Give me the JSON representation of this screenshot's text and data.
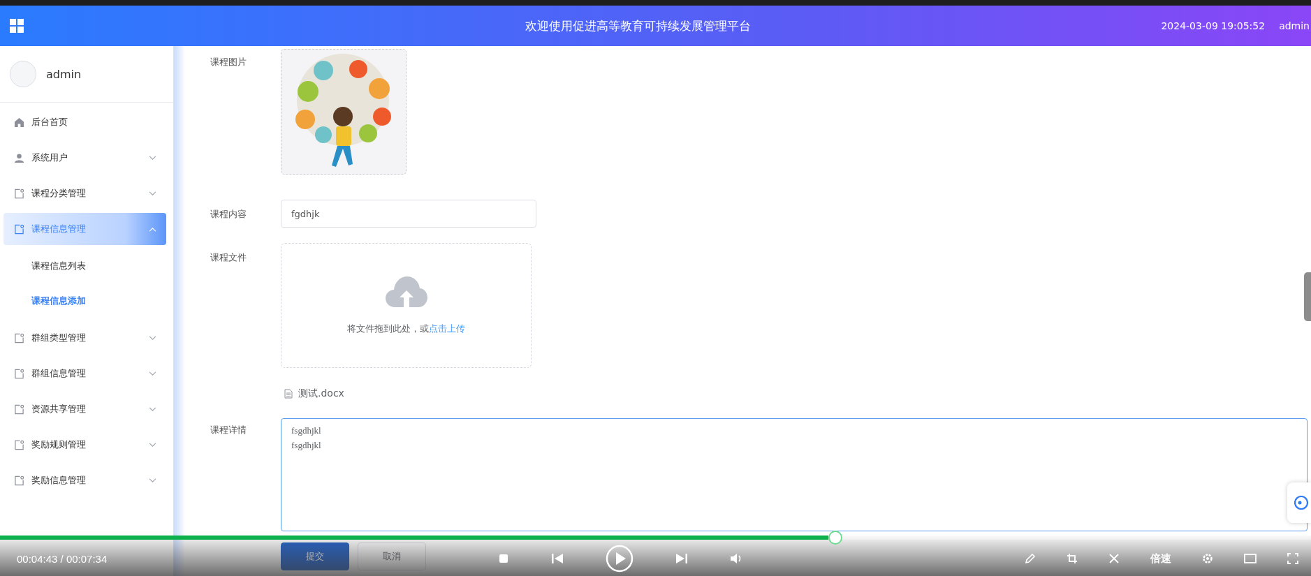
{
  "header": {
    "title": "欢迎使用促进高等教育可持续发展管理平台",
    "datetime": "2024-03-09 19:05:52",
    "user": "admin"
  },
  "sidebar": {
    "user": "admin",
    "items": [
      {
        "label": "后台首页",
        "selected": false
      },
      {
        "label": "系统用户",
        "selected": false,
        "expanded": false
      },
      {
        "label": "课程分类管理",
        "selected": false,
        "expanded": false
      },
      {
        "label": "课程信息管理",
        "selected": true,
        "expanded": true,
        "children": [
          {
            "label": "课程信息列表",
            "selected": false
          },
          {
            "label": "课程信息添加",
            "selected": true
          }
        ]
      },
      {
        "label": "群组类型管理",
        "selected": false,
        "expanded": false
      },
      {
        "label": "群组信息管理",
        "selected": false,
        "expanded": false
      },
      {
        "label": "资源共享管理",
        "selected": false,
        "expanded": false
      },
      {
        "label": "奖励规则管理",
        "selected": false,
        "expanded": false
      },
      {
        "label": "奖励信息管理",
        "selected": false,
        "expanded": false
      }
    ]
  },
  "form": {
    "fields": [
      {
        "label": "课程图片"
      },
      {
        "kind": "input",
        "label": "课程内容",
        "value": "fgdhjk"
      },
      {
        "kind": "upload",
        "label": "课程文件",
        "hint": "将文件拖到此处，或",
        "link": "点击上传",
        "files": [
          "测试.docx"
        ]
      },
      {
        "kind": "textarea",
        "label": "课程详情",
        "value": "fsgdhjkl\nfsgdhjkl"
      }
    ],
    "buttons": [
      {
        "label": "提交",
        "kind": "primary"
      },
      {
        "label": "取消",
        "kind": "default"
      }
    ]
  },
  "player": {
    "time": "00:04:43 / 00:07:34",
    "level": 0.632,
    "speed": "倍速"
  }
}
